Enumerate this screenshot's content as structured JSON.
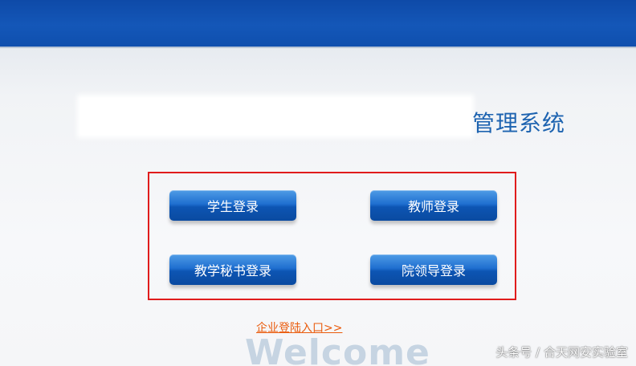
{
  "header": {
    "title_suffix": "管理系统"
  },
  "login": {
    "student_label": "学生登录",
    "teacher_label": "教师登录",
    "secretary_label": "教学秘书登录",
    "leader_label": "院领导登录"
  },
  "enterprise_link": "企业登陆入口>>",
  "welcome_text": "Welcome",
  "watermark": "头条号 / 合天网安实验室",
  "colors": {
    "banner": "#1457b8",
    "button": "#1f6fd0",
    "highlight_frame": "#e01c1c",
    "link": "#ea5b0c",
    "title": "#1d63b0"
  }
}
